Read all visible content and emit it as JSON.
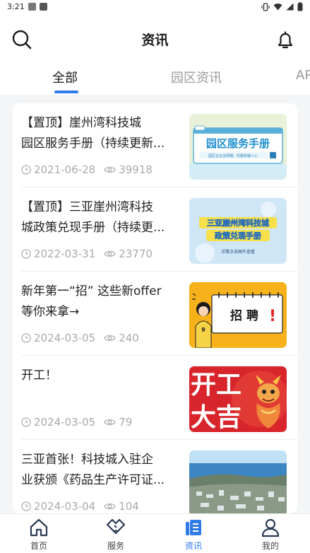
{
  "status_bar": {
    "time": "3:21"
  },
  "header": {
    "title": "资讯"
  },
  "tabs": [
    {
      "label": "全部"
    },
    {
      "label": "园区资讯"
    },
    {
      "label": "AP"
    }
  ],
  "articles": [
    {
      "title_line1": "【置顶】崖州湾科技城",
      "title_line2": "园区服务手册（持续更新...",
      "date": "2021-06-28",
      "views": "39918",
      "thumb": {
        "heading": "园区服务手册",
        "subtext": "园区企业全周期，优服务暖人心"
      }
    },
    {
      "title_line1": "【置顶】三亚崖州湾科技",
      "title_line2": "城政策兑现手册（持续更...",
      "date": "2022-03-31",
      "views": "23770",
      "thumb": {
        "heading_line1": "三亚崖州湾科技城",
        "heading_line2": "政策兑现手册",
        "subtext": "详情点击图片查看"
      }
    },
    {
      "title_line1": "新年第一“招” 这些新offer",
      "title_line2": "等你来拿→",
      "date": "2024-03-05",
      "views": "240",
      "thumb": {
        "heading": "招 聘",
        "mark": "!"
      }
    },
    {
      "title_line1": "开工！",
      "title_line2": "",
      "date": "2024-03-05",
      "views": "79",
      "thumb": {
        "heading_line1": "开工",
        "heading_line2": "大吉"
      }
    },
    {
      "title_line1": "三亚首张！科技城入驻企",
      "title_line2": "业获颁《药品生产许可证...",
      "date": "2024-03-04",
      "views": "104",
      "thumb": {}
    }
  ],
  "bottom_nav": [
    {
      "label": "首页",
      "icon": "home-icon"
    },
    {
      "label": "服务",
      "icon": "service-icon"
    },
    {
      "label": "资讯",
      "icon": "news-icon",
      "active": true
    },
    {
      "label": "我的",
      "icon": "profile-icon"
    }
  ],
  "colors": {
    "accent": "#2f7ae5",
    "meta_text": "#a9a9a9",
    "background": "#f4f5f7"
  }
}
